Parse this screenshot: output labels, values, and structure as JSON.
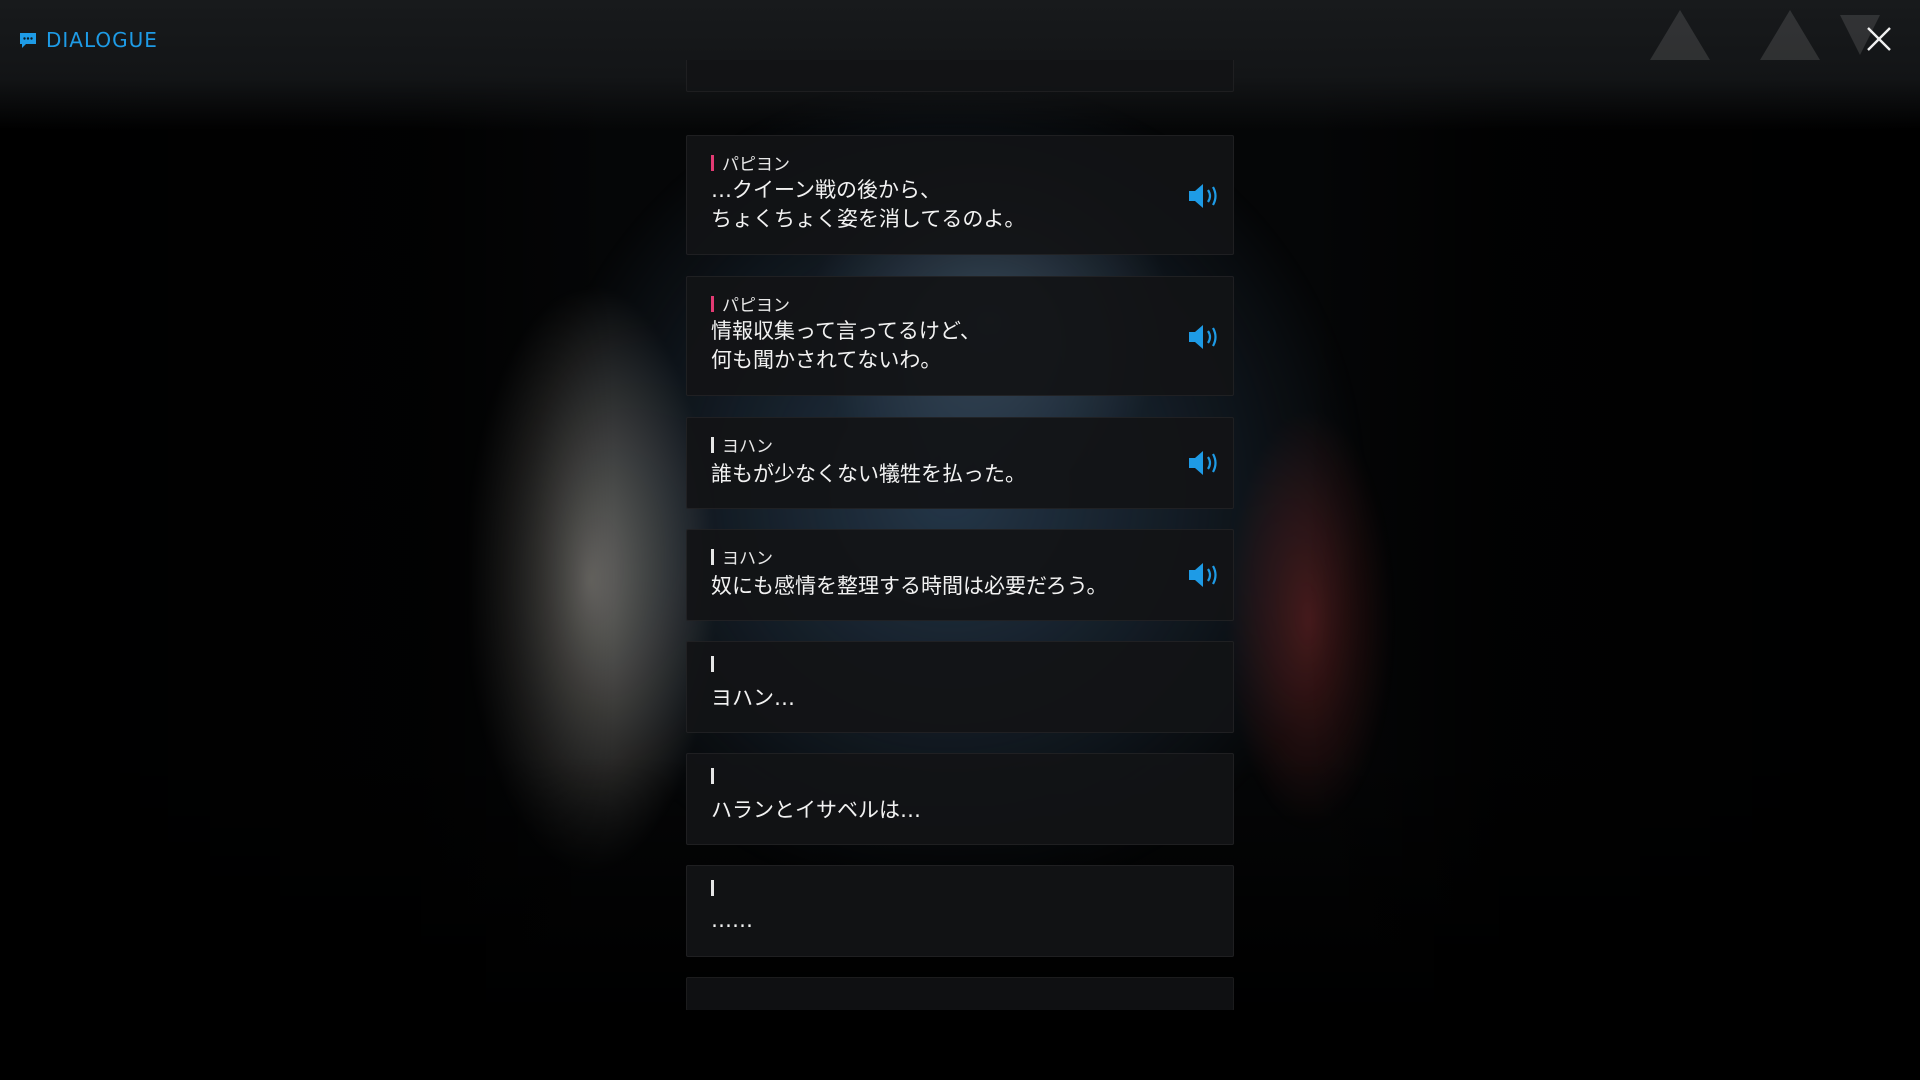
{
  "header": {
    "title": "DIALOGUE",
    "icon": "chat-bubble-icon",
    "accent": "#1e9be6"
  },
  "close": {
    "icon": "close-icon"
  },
  "dialogue": [
    {
      "speaker": "パピヨン",
      "text": "…クイーン戦の後から、\nちょくちょく姿を消してるのよ。",
      "voice": true,
      "accent": "#e33a73"
    },
    {
      "speaker": "パピヨン",
      "text": "情報収集って言ってるけど、\n何も聞かされてないわ。",
      "voice": true,
      "accent": "#e33a73"
    },
    {
      "speaker": "ヨハン",
      "text": "誰もが少なくない犠牲を払った。",
      "voice": true,
      "accent": "#e6e6e6"
    },
    {
      "speaker": "ヨハン",
      "text": "奴にも感情を整理する時間は必要だろう。",
      "voice": true,
      "accent": "#e6e6e6"
    },
    {
      "speaker": "",
      "text": "ヨハン…",
      "voice": false,
      "accent": "#e6e6e6"
    },
    {
      "speaker": "",
      "text": "ハランとイサベルは…",
      "voice": false,
      "accent": "#e6e6e6"
    },
    {
      "speaker": "",
      "text": "……",
      "voice": false,
      "accent": "#e6e6e6"
    }
  ]
}
